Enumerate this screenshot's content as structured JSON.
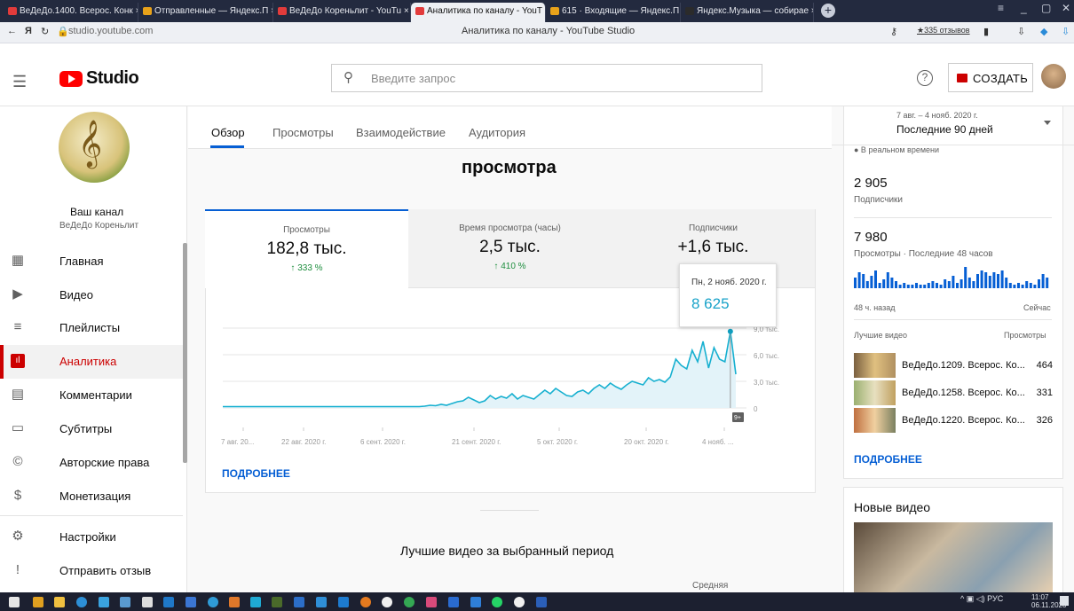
{
  "browser": {
    "tabs": [
      {
        "label": "ВеДеДо.1400. Всерос. Конк ×",
        "color": "#e23b3b"
      },
      {
        "label": "Отправленные — Яндекс.П ×",
        "color": "#e8a21a"
      },
      {
        "label": "ВеДеДо Кореньлит - YouTu ×",
        "color": "#e23b3b"
      },
      {
        "label": "Аналитика по каналу - YouT ×",
        "color": "#e23b3b"
      },
      {
        "label": "615 · Входящие — Яндекс.П ×",
        "color": "#e8a21a"
      },
      {
        "label": "Яндекс.Музыка — собирае ×",
        "color": "#2b2b2b"
      }
    ],
    "url": "studio.youtube.com",
    "page_title": "Аналитика по каналу - YouTube Studio",
    "reviews": "★335 отзывов"
  },
  "header": {
    "logo": "Studio",
    "search_placeholder": "Введите запрос",
    "create_label": "СОЗДАТЬ"
  },
  "channel": {
    "title": "Ваш канал",
    "name": "ВеДеДо Кореньлит"
  },
  "sidebar": {
    "items": [
      {
        "label": "Главная",
        "icon": "dashboard-icon"
      },
      {
        "label": "Видео",
        "icon": "video-icon"
      },
      {
        "label": "Плейлисты",
        "icon": "playlist-icon"
      },
      {
        "label": "Аналитика",
        "icon": "analytics-icon"
      },
      {
        "label": "Комментарии",
        "icon": "comments-icon"
      },
      {
        "label": "Субтитры",
        "icon": "subtitles-icon"
      },
      {
        "label": "Авторские права",
        "icon": "copyright-icon"
      },
      {
        "label": "Монетизация",
        "icon": "dollar-icon"
      },
      {
        "label": "Настройки",
        "icon": "gear-icon"
      },
      {
        "label": "Отправить отзыв",
        "icon": "feedback-icon"
      }
    ]
  },
  "tabs": [
    "Обзор",
    "Просмотры",
    "Взаимодействие",
    "Аудитория"
  ],
  "main": {
    "section_title": "просмотра",
    "metrics": [
      {
        "label": "Просмотры",
        "value": "182,8 тыс.",
        "delta": "↑ 333 %"
      },
      {
        "label": "Время просмотра (часы)",
        "value": "2,5 тыс.",
        "delta": "↑ 410 %"
      },
      {
        "label": "Подписчики",
        "value": "+1,6 тыс.",
        "delta": ""
      }
    ],
    "tooltip": {
      "date": "Пн, 2 нояб. 2020 г.",
      "value": "8 625"
    },
    "more": "ПОДРОБНЕЕ",
    "top_videos_title": "Лучшие видео за выбранный период",
    "avg_label": "Средняя"
  },
  "chart_data": {
    "type": "area",
    "y_ticks": [
      "9,0 тыс.",
      "6,0 тыс.",
      "3,0 тыс.",
      "0"
    ],
    "x_ticks": [
      "7 авг. 20...",
      "22 авг. 2020 г.",
      "6 сент. 2020 г.",
      "21 сент. 2020 г.",
      "5 окт. 2020 г.",
      "20 окт. 2020 г.",
      "4 нояб. ..."
    ],
    "ylim": [
      0,
      9000
    ],
    "badge": "9+",
    "values": [
      150,
      150,
      150,
      150,
      150,
      150,
      150,
      150,
      150,
      150,
      150,
      150,
      150,
      150,
      150,
      150,
      150,
      150,
      150,
      150,
      150,
      150,
      150,
      150,
      150,
      150,
      150,
      150,
      150,
      150,
      150,
      150,
      150,
      150,
      150,
      150,
      150,
      200,
      300,
      250,
      400,
      300,
      500,
      700,
      800,
      1200,
      900,
      600,
      800,
      1400,
      1000,
      1300,
      1100,
      1600,
      1000,
      1400,
      1200,
      1000,
      1500,
      2000,
      1600,
      2200,
      1800,
      1400,
      1300,
      1800,
      2000,
      1600,
      2200,
      2600,
      2200,
      2800,
      2400,
      2100,
      2600,
      3000,
      2800,
      2600,
      3400,
      3000,
      3200,
      2900,
      3500,
      5500,
      4800,
      4400,
      6500,
      5200,
      7500,
      4500,
      6800,
      5500,
      5200,
      8625,
      3800
    ]
  },
  "right": {
    "range_dates": "7 авг. – 4 нояб. 2020 г.",
    "range_label": "Последние 90 дней",
    "realtime": "● В реальном времени",
    "subs_value": "2 905",
    "subs_label": "Подписчики",
    "views_value": "7 980",
    "views_label": "Просмотры · Последние 48 часов",
    "spark_left": "48 ч. назад",
    "spark_right": "Сейчас",
    "top_label": "Лучшие видео",
    "top_col": "Просмотры",
    "videos": [
      {
        "title": "ВеДеДо.1209. Всерос. Ко...",
        "views": "464"
      },
      {
        "title": "ВеДеДо.1258. Всерос. Ко...",
        "views": "331"
      },
      {
        "title": "ВеДеДо.1220. Всерос. Ко...",
        "views": "326"
      }
    ],
    "more": "ПОДРОБНЕЕ",
    "new_videos": "Новые видео"
  },
  "taskbar": {
    "lang": "РУС",
    "time": "11:07",
    "date": "06.11.2020"
  }
}
